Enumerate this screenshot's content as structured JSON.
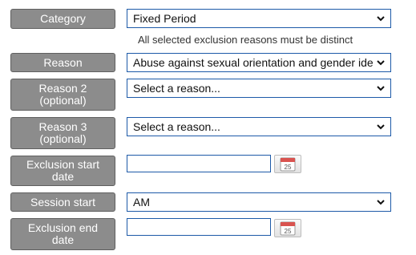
{
  "form": {
    "category": {
      "label": "Category",
      "value": "Fixed Period"
    },
    "hint": "All selected exclusion reasons must be distinct",
    "reason": {
      "label": "Reason",
      "value": "Abuse against sexual orientation and gender identity"
    },
    "reason2": {
      "label_line1": "Reason 2",
      "label_line2": "(optional)",
      "value": "Select a reason..."
    },
    "reason3": {
      "label_line1": "Reason 3",
      "label_line2": "(optional)",
      "value": "Select a reason..."
    },
    "exclusion_start": {
      "label_line1": "Exclusion start",
      "label_line2": "date",
      "value": ""
    },
    "session_start": {
      "label": "Session start",
      "value": "AM"
    },
    "exclusion_end": {
      "label_line1": "Exclusion end",
      "label_line2": "date",
      "value": ""
    },
    "calendar_day": "25"
  },
  "icons": {
    "dropdown": "chevron-down-icon",
    "calendar": "calendar-icon"
  },
  "colors": {
    "label_bg": "#8c8c8c",
    "field_border": "#1d5aa8"
  }
}
